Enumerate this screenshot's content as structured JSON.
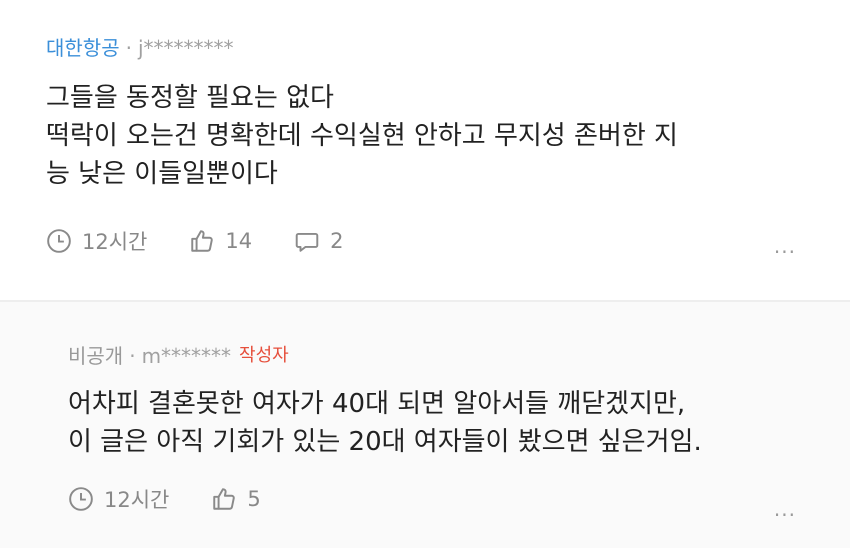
{
  "comments": [
    {
      "group": "대한항공",
      "separator": "·",
      "user": "j*********",
      "lines": [
        "그들을 동정할 필요는 없다",
        "떡락이 오는건 명확한데 수익실현 안하고 무지성 존버한 지",
        "능 낮은 이들일뿐이다"
      ],
      "time": "12시간",
      "likes": "14",
      "replies": "2",
      "more": "···"
    },
    {
      "group": "비공개",
      "separator": "·",
      "user": "m*******",
      "author_tag": "작성자",
      "lines": [
        "어차피 결혼못한 여자가 40대 되면 알아서들 깨닫겠지만,",
        "이 글은 아직 기회가 있는 20대 여자들이 봤으면 싶은거임."
      ],
      "time": "12시간",
      "likes": "5",
      "more": "···"
    }
  ],
  "colors": {
    "group_link": "#3b8fd9",
    "author_tag": "#e64f3c",
    "meta_gray": "#a0a0a0",
    "action_gray": "#888888",
    "reply_bg": "#fafafa"
  },
  "icons": [
    "clock-icon",
    "thumbs-up-icon",
    "speech-bubble-icon",
    "more-icon"
  ]
}
